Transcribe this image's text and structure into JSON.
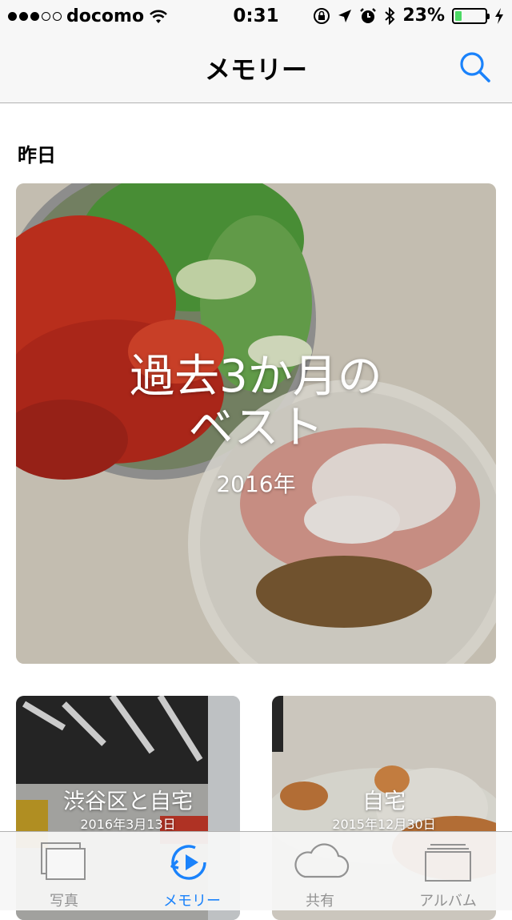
{
  "status_bar": {
    "carrier": "docomo",
    "signal_bars_filled": 3,
    "signal_bars_total": 5,
    "time": "0:31",
    "battery_percent": "23%",
    "battery_level": 0.23
  },
  "nav": {
    "title": "メモリー",
    "search_icon": "search-icon"
  },
  "section": {
    "title": "昨日"
  },
  "featured_memory": {
    "title_line1": "過去3か月の",
    "title_line2": "ベスト",
    "subtitle": "2016年"
  },
  "memories": [
    {
      "title": "渋谷区と自宅",
      "date": "2016年3月13日"
    },
    {
      "title": "自宅",
      "date": "2015年12月30日"
    }
  ],
  "tab_bar": {
    "tabs": [
      {
        "label": "写真",
        "icon": "photos-icon"
      },
      {
        "label": "メモリー",
        "icon": "memories-icon"
      },
      {
        "label": "共有",
        "icon": "cloud-icon"
      },
      {
        "label": "アルバム",
        "icon": "albums-icon"
      }
    ],
    "active_index": 1
  },
  "colors": {
    "accent": "#1a82fb",
    "battery_fill": "#4cd964",
    "inactive_tab": "#929292"
  }
}
